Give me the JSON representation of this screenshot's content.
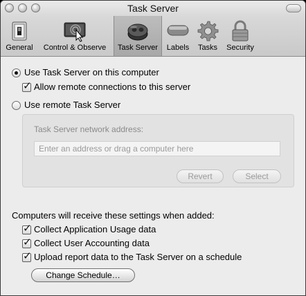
{
  "window": {
    "title": "Task Server"
  },
  "toolbar": {
    "items": [
      {
        "label": "General",
        "icon": "switch-icon"
      },
      {
        "label": "Control & Observe",
        "icon": "screen-cursor-icon"
      },
      {
        "label": "Task Server",
        "icon": "server-icon",
        "selected": true
      },
      {
        "label": "Labels",
        "icon": "label-icon"
      },
      {
        "label": "Tasks",
        "icon": "gear-icon"
      },
      {
        "label": "Security",
        "icon": "lock-icon"
      }
    ]
  },
  "server": {
    "use_local_label": "Use Task Server on this computer",
    "use_local_selected": true,
    "allow_remote_label": "Allow remote connections to this server",
    "allow_remote_checked": true,
    "use_remote_label": "Use remote Task Server",
    "use_remote_selected": false,
    "address_label": "Task Server network address:",
    "address_placeholder": "Enter an address or drag a computer here",
    "revert_label": "Revert",
    "select_label": "Select"
  },
  "computers": {
    "heading": "Computers will receive these settings when added:",
    "options": [
      {
        "label": "Collect Application Usage data",
        "checked": true
      },
      {
        "label": "Collect User Accounting data",
        "checked": true
      },
      {
        "label": "Upload report data to the Task Server on a schedule",
        "checked": true
      }
    ],
    "change_schedule_label": "Change Schedule…"
  },
  "colors": {
    "window_bg": "#ececec",
    "selected_tab": "#b4b4b4"
  }
}
